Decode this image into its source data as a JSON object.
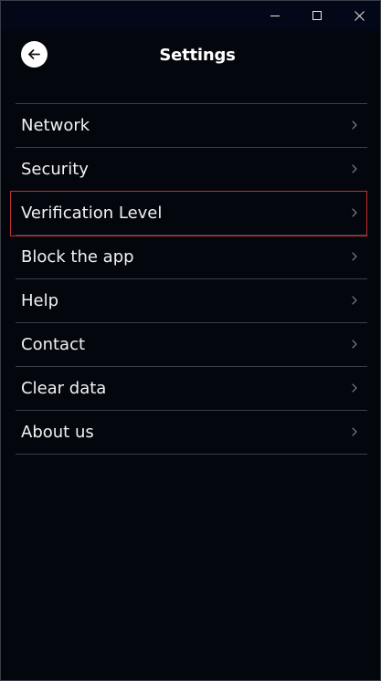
{
  "window": {
    "controls": {
      "minimize_icon": "minimize-icon",
      "maximize_icon": "maximize-icon",
      "close_icon": "close-icon"
    }
  },
  "header": {
    "title": "Settings",
    "back_icon": "arrow-left-icon"
  },
  "menu": {
    "items": [
      {
        "label": "Network",
        "selected": false
      },
      {
        "label": "Security",
        "selected": false
      },
      {
        "label": "Verification Level",
        "selected": true
      },
      {
        "label": "Block the app",
        "selected": false
      },
      {
        "label": "Help",
        "selected": false
      },
      {
        "label": "Contact",
        "selected": false
      },
      {
        "label": "Clear data",
        "selected": false
      },
      {
        "label": "About us",
        "selected": false
      }
    ],
    "chevron_icon": "chevron-right-icon"
  },
  "colors": {
    "background": "#03060d",
    "titlebar": "#020817",
    "text": "#f2f2f2",
    "divider": "#3b3f46",
    "selection_outline": "#c4302f"
  }
}
